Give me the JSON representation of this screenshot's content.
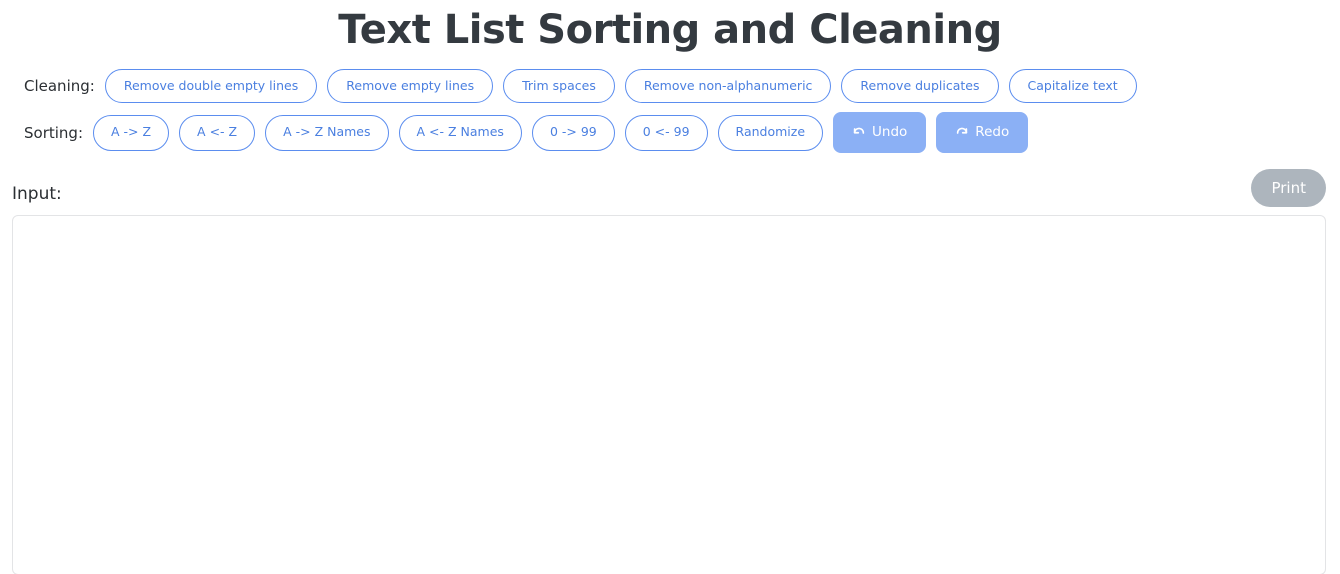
{
  "page": {
    "title": "Text List Sorting and Cleaning"
  },
  "colors": {
    "title_text": "#343a40",
    "button_blue": "#5b8def",
    "button_blue_text": "#4a7fe0",
    "filled_button_bg": "#8bb0f5",
    "filled_button_text": "#ffffff",
    "print_button_bg": "#adb5bd",
    "input_border": "#e3e4e6",
    "background": "#ffffff"
  },
  "cleaning": {
    "label": "Cleaning:",
    "buttons": [
      {
        "label": "Remove double empty lines"
      },
      {
        "label": "Remove empty lines"
      },
      {
        "label": "Trim spaces"
      },
      {
        "label": "Remove non-alphanumeric"
      },
      {
        "label": "Remove duplicates"
      },
      {
        "label": "Capitalize text"
      }
    ]
  },
  "sorting": {
    "label": "Sorting:",
    "buttons": [
      {
        "label": "A -> Z"
      },
      {
        "label": "A <- Z"
      },
      {
        "label": "A -> Z Names"
      },
      {
        "label": "A <- Z Names"
      },
      {
        "label": "0 -> 99"
      },
      {
        "label": "0 <- 99"
      },
      {
        "label": "Randomize"
      }
    ],
    "history": [
      {
        "label": "Undo",
        "icon": "undo-arrow-icon"
      },
      {
        "label": "Redo",
        "icon": "redo-arrow-icon"
      }
    ]
  },
  "input_section": {
    "label": "Input:",
    "print_label": "Print",
    "textarea_value": "",
    "textarea_placeholder": ""
  }
}
